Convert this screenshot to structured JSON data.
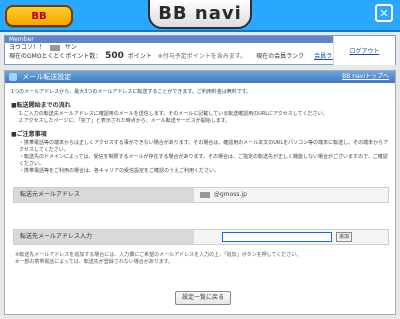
{
  "header": {
    "left_logo_text": "BB",
    "center_logo_text": "BB navi",
    "close_icon": "close-icon"
  },
  "member": {
    "label": "Member",
    "greeting_prefix": "ヨウコソ！！",
    "greeting_suffix": "サン",
    "points_label": "現在のGMOとくとくポイント数：",
    "points_value": "500",
    "points_unit": "ポイント",
    "note": "※付与予定ポイントを含みます。",
    "rank_label": "現在の会員ランク",
    "rank_link": "会員ランクとは",
    "logout": "ログアウト"
  },
  "panel": {
    "title": "メール転送設定",
    "back_link": "BB naviトップへ",
    "intro": "1つのメールアドレスから、最大3つのメールアドレスに転送することができます。ご利用料金は無料です。",
    "section1_title": "■転送開始までの流れ",
    "section1_items": [
      "1.ご入力の転送先メールアドレスに確認用のメールを送信します。そのメールに記載している転送確認用のURLにアクセスしてください。",
      "2.アクセスしたページに、「完了」と表示された時点から、メール転送サービスが開始します。"
    ],
    "section2_title": "■ご注意事項",
    "section2_items": [
      "・携帯電話等の端末からは正しくアクセスする事ができない場合があります。その場合は、確認用のメール本文のURLをパソコン等の端末に転送し、その端末からアクセスしてください。",
      "・転送先のドメインによっては、受信を制限するメールが存在する場合があります。その場合は、ご指定の転送先が正しく機能しない場合がございますので、ご確認ください。",
      "・携帯電話等をご利用の場合は、各キャリアの受信設定をご確認のうえご利用ください。"
    ],
    "from_label": "転送元メールアドレス",
    "from_value": "@gmoss.jp",
    "to_label": "転送先メールアドレス入力",
    "to_placeholder": "",
    "add_button": "追加",
    "after_note": "※転送先メールアドレスを追加する場合には、入力欄にご希望のメールアドレスを入力の上、「追加」ボタンを押してください。",
    "after_note2": "※一部の携帯電話によっては、転送先が登録されない場合があります。",
    "back_button": "設定一覧に戻る"
  }
}
